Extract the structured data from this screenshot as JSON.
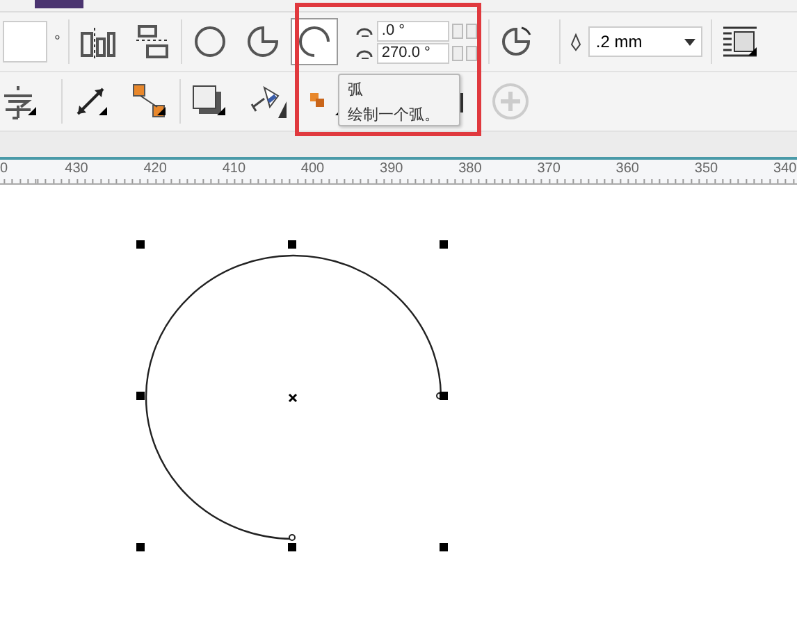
{
  "property_bar": {
    "partial_field_unit": "°",
    "arc_tool": {
      "selected": true
    },
    "angle_fields": [
      {
        "value": ".0 °"
      },
      {
        "value": "270.0 °"
      }
    ],
    "outline_width": ".2 mm"
  },
  "tooltip": {
    "title": "弧",
    "description": "绘制一个弧。"
  },
  "ruler": {
    "labels": [
      "0",
      "430",
      "420",
      "410",
      "400",
      "390",
      "380",
      "370",
      "360",
      "350",
      "340"
    ]
  }
}
